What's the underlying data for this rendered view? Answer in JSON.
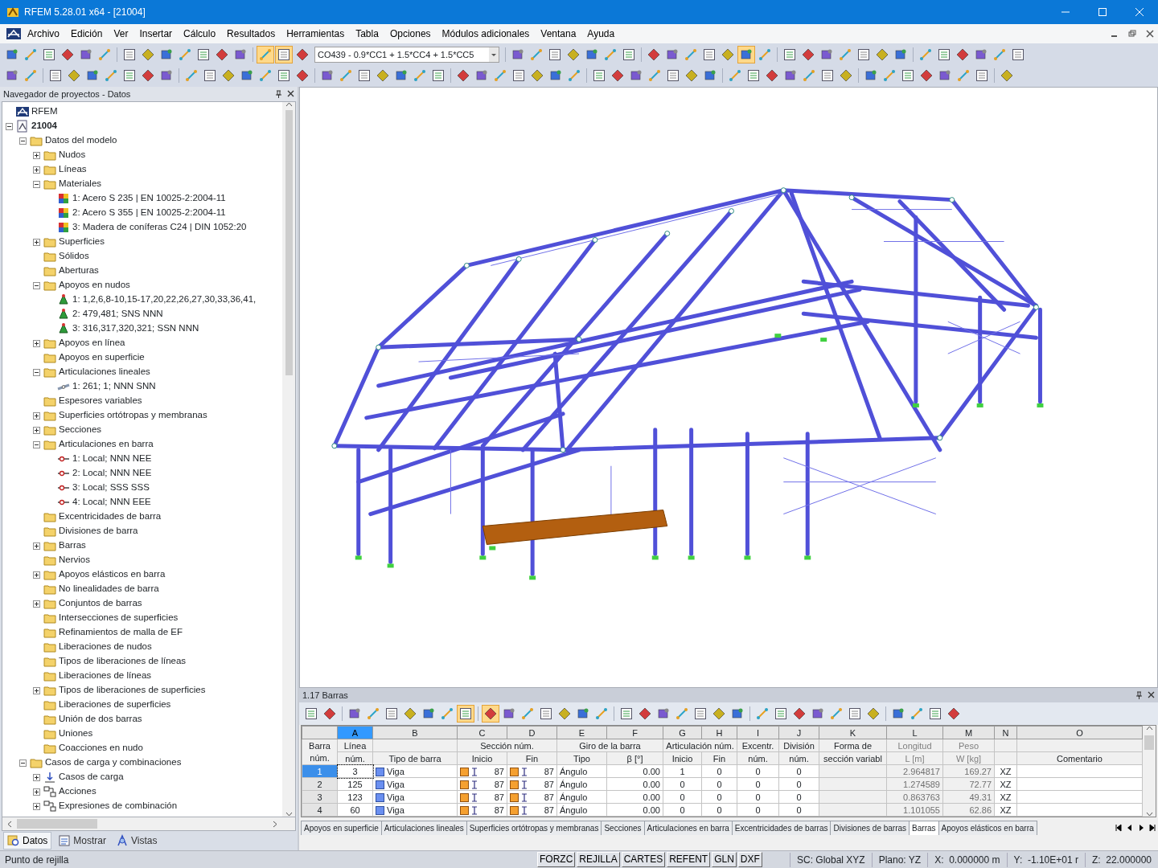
{
  "window": {
    "title": "RFEM 5.28.01 x64 - [21004]"
  },
  "menu": [
    "Archivo",
    "Edición",
    "Ver",
    "Insertar",
    "Cálculo",
    "Resultados",
    "Herramientas",
    "Tabla",
    "Opciones",
    "Módulos adicionales",
    "Ventana",
    "Ayuda"
  ],
  "toolbar": {
    "combo": "CO439 - 0.9*CC1 + 1.5*CC4 + 1.5*CC5"
  },
  "navigator": {
    "title": "Navegador de proyectos - Datos",
    "tree": [
      {
        "label": "RFEM",
        "kind": "root"
      },
      {
        "label": "21004",
        "kind": "model",
        "expanded": true,
        "children": [
          {
            "label": "Datos del modelo",
            "kind": "folder",
            "expanded": true,
            "children": [
              {
                "label": "Nudos",
                "kind": "folder",
                "expanded": false
              },
              {
                "label": "Líneas",
                "kind": "folder",
                "expanded": false
              },
              {
                "label": "Materiales",
                "kind": "folder",
                "expanded": true,
                "children": [
                  {
                    "label": "1: Acero S 235 | EN 10025-2:2004-11",
                    "kind": "material"
                  },
                  {
                    "label": "2: Acero S 355 | EN 10025-2:2004-11",
                    "kind": "material"
                  },
                  {
                    "label": "3: Madera de coníferas C24 | DIN 1052:20",
                    "kind": "material"
                  }
                ]
              },
              {
                "label": "Superficies",
                "kind": "folder",
                "expanded": false
              },
              {
                "label": "Sólidos",
                "kind": "folder"
              },
              {
                "label": "Aberturas",
                "kind": "folder"
              },
              {
                "label": "Apoyos en nudos",
                "kind": "folder",
                "expanded": true,
                "children": [
                  {
                    "label": "1: 1,2,6,8-10,15-17,20,22,26,27,30,33,36,41,",
                    "kind": "support"
                  },
                  {
                    "label": "2: 479,481; SNS NNN",
                    "kind": "support"
                  },
                  {
                    "label": "3: 316,317,320,321; SSN NNN",
                    "kind": "support"
                  }
                ]
              },
              {
                "label": "Apoyos en línea",
                "kind": "folder",
                "expanded": false
              },
              {
                "label": "Apoyos en superficie",
                "kind": "folder"
              },
              {
                "label": "Articulaciones lineales",
                "kind": "folder",
                "expanded": true,
                "children": [
                  {
                    "label": "1: 261; 1; NNN SNN",
                    "kind": "line-hinge"
                  }
                ]
              },
              {
                "label": "Espesores variables",
                "kind": "folder"
              },
              {
                "label": "Superficies ortótropas y membranas",
                "kind": "folder",
                "expanded": false
              },
              {
                "label": "Secciones",
                "kind": "folder",
                "expanded": false
              },
              {
                "label": "Articulaciones en barra",
                "kind": "folder",
                "expanded": true,
                "children": [
                  {
                    "label": "1: Local; NNN NEE",
                    "kind": "member-hinge"
                  },
                  {
                    "label": "2: Local; NNN NEE",
                    "kind": "member-hinge"
                  },
                  {
                    "label": "3: Local; SSS SSS",
                    "kind": "member-hinge"
                  },
                  {
                    "label": "4: Local; NNN EEE",
                    "kind": "member-hinge"
                  }
                ]
              },
              {
                "label": "Excentricidades de barra",
                "kind": "folder"
              },
              {
                "label": "Divisiones de barra",
                "kind": "folder"
              },
              {
                "label": "Barras",
                "kind": "folder",
                "expanded": false
              },
              {
                "label": "Nervios",
                "kind": "folder"
              },
              {
                "label": "Apoyos elásticos en barra",
                "kind": "folder",
                "expanded": false
              },
              {
                "label": "No linealidades de barra",
                "kind": "folder"
              },
              {
                "label": "Conjuntos de barras",
                "kind": "folder",
                "expanded": false
              },
              {
                "label": "Intersecciones de superficies",
                "kind": "folder"
              },
              {
                "label": "Refinamientos de malla de EF",
                "kind": "folder"
              },
              {
                "label": "Liberaciones de nudos",
                "kind": "folder"
              },
              {
                "label": "Tipos de liberaciones de líneas",
                "kind": "folder"
              },
              {
                "label": "Liberaciones de líneas",
                "kind": "folder"
              },
              {
                "label": "Tipos de liberaciones de superficies",
                "kind": "folder",
                "expanded": false
              },
              {
                "label": "Liberaciones de superficies",
                "kind": "folder"
              },
              {
                "label": "Unión de dos barras",
                "kind": "folder"
              },
              {
                "label": "Uniones",
                "kind": "folder"
              },
              {
                "label": "Coacciones en nudo",
                "kind": "folder"
              }
            ]
          },
          {
            "label": "Casos de carga y combinaciones",
            "kind": "folder",
            "expanded": true,
            "children": [
              {
                "label": "Casos de carga",
                "kind": "load",
                "expanded": false
              },
              {
                "label": "Acciones",
                "kind": "combination",
                "expanded": false
              },
              {
                "label": "Expresiones de combinación",
                "kind": "combination",
                "expanded": false
              }
            ]
          }
        ]
      }
    ],
    "tabs": [
      {
        "label": "Datos",
        "selected": true
      },
      {
        "label": "Mostrar",
        "selected": false
      },
      {
        "label": "Vistas",
        "selected": false
      }
    ]
  },
  "table_panel": {
    "title": "1.17 Barras",
    "row_header": "Barra núm.",
    "columns": [
      {
        "letter": "A",
        "selected": true,
        "top": "Línea",
        "bottom": "núm."
      },
      {
        "letter": "B",
        "selected": false,
        "bottom": "Tipo de barra"
      },
      {
        "letter": "C",
        "selected": false,
        "group": "Sección núm.",
        "bottom": "Inicio"
      },
      {
        "letter": "D",
        "selected": false,
        "bottom": "Fin"
      },
      {
        "letter": "E",
        "selected": false,
        "group": "Giro de la barra",
        "bottom": "Tipo"
      },
      {
        "letter": "F",
        "selected": false,
        "bottom": "β [°]"
      },
      {
        "letter": "G",
        "selected": false,
        "group": "Articulación núm.",
        "bottom": "Inicio"
      },
      {
        "letter": "H",
        "selected": false,
        "bottom": "Fin"
      },
      {
        "letter": "I",
        "selected": false,
        "top": "Excentr.",
        "bottom": "núm."
      },
      {
        "letter": "J",
        "selected": false,
        "top": "División",
        "bottom": "núm."
      },
      {
        "letter": "K",
        "selected": false,
        "top": "Forma de",
        "bottom": "sección variabl"
      },
      {
        "letter": "L",
        "selected": false,
        "top": "Longitud",
        "bottom": "L [m]"
      },
      {
        "letter": "M",
        "selected": false,
        "top": "Peso",
        "bottom": "W [kg]"
      },
      {
        "letter": "N",
        "selected": false
      },
      {
        "letter": "O",
        "selected": false,
        "bottom": "Comentario"
      }
    ],
    "rows": [
      {
        "number": "1",
        "selected": true,
        "line": "3",
        "member_type": "Viga",
        "section_start": "87",
        "section_end": "87",
        "rotation_type": "Ángulo",
        "beta": "0.00",
        "hinge_start": "1",
        "hinge_end": "0",
        "eccentricity": "0",
        "division": "0",
        "length": "2.964817",
        "weight": "169.27",
        "plane": "XZ"
      },
      {
        "number": "2",
        "selected": false,
        "line": "125",
        "member_type": "Viga",
        "section_start": "87",
        "section_end": "87",
        "rotation_type": "Ángulo",
        "beta": "0.00",
        "hinge_start": "0",
        "hinge_end": "0",
        "eccentricity": "0",
        "division": "0",
        "length": "1.274589",
        "weight": "72.77",
        "plane": "XZ"
      },
      {
        "number": "3",
        "selected": false,
        "line": "123",
        "member_type": "Viga",
        "section_start": "87",
        "section_end": "87",
        "rotation_type": "Ángulo",
        "beta": "0.00",
        "hinge_start": "0",
        "hinge_end": "0",
        "eccentricity": "0",
        "division": "0",
        "length": "0.863763",
        "weight": "49.31",
        "plane": "XZ"
      },
      {
        "number": "4",
        "selected": false,
        "line": "60",
        "member_type": "Viga",
        "section_start": "87",
        "section_end": "87",
        "rotation_type": "Ángulo",
        "beta": "0.00",
        "hinge_start": "0",
        "hinge_end": "0",
        "eccentricity": "0",
        "division": "0",
        "length": "1.101055",
        "weight": "62.86",
        "plane": "XZ"
      }
    ],
    "sheet_tabs": [
      {
        "label": "Apoyos en superficie",
        "selected": false
      },
      {
        "label": "Articulaciones lineales",
        "selected": false
      },
      {
        "label": "Superficies ortótropas y membranas",
        "selected": false
      },
      {
        "label": "Secciones",
        "selected": false
      },
      {
        "label": "Articulaciones en barra",
        "selected": false
      },
      {
        "label": "Excentricidades de barras",
        "selected": false
      },
      {
        "label": "Divisiones de barras",
        "selected": false
      },
      {
        "label": "Barras",
        "selected": true
      },
      {
        "label": "Apoyos elásticos en barra",
        "selected": false
      }
    ]
  },
  "status_bar": {
    "message": "Punto de rejilla",
    "toggles": [
      "FORZC",
      "REJILLA",
      "CARTES",
      "REFENT",
      "GLN",
      "DXF"
    ],
    "fields": [
      "SC: Global XYZ",
      "Plano: YZ",
      "X:  0.000000 m",
      "Y:  -1.10E+01 r",
      "Z:  22.000000"
    ]
  }
}
